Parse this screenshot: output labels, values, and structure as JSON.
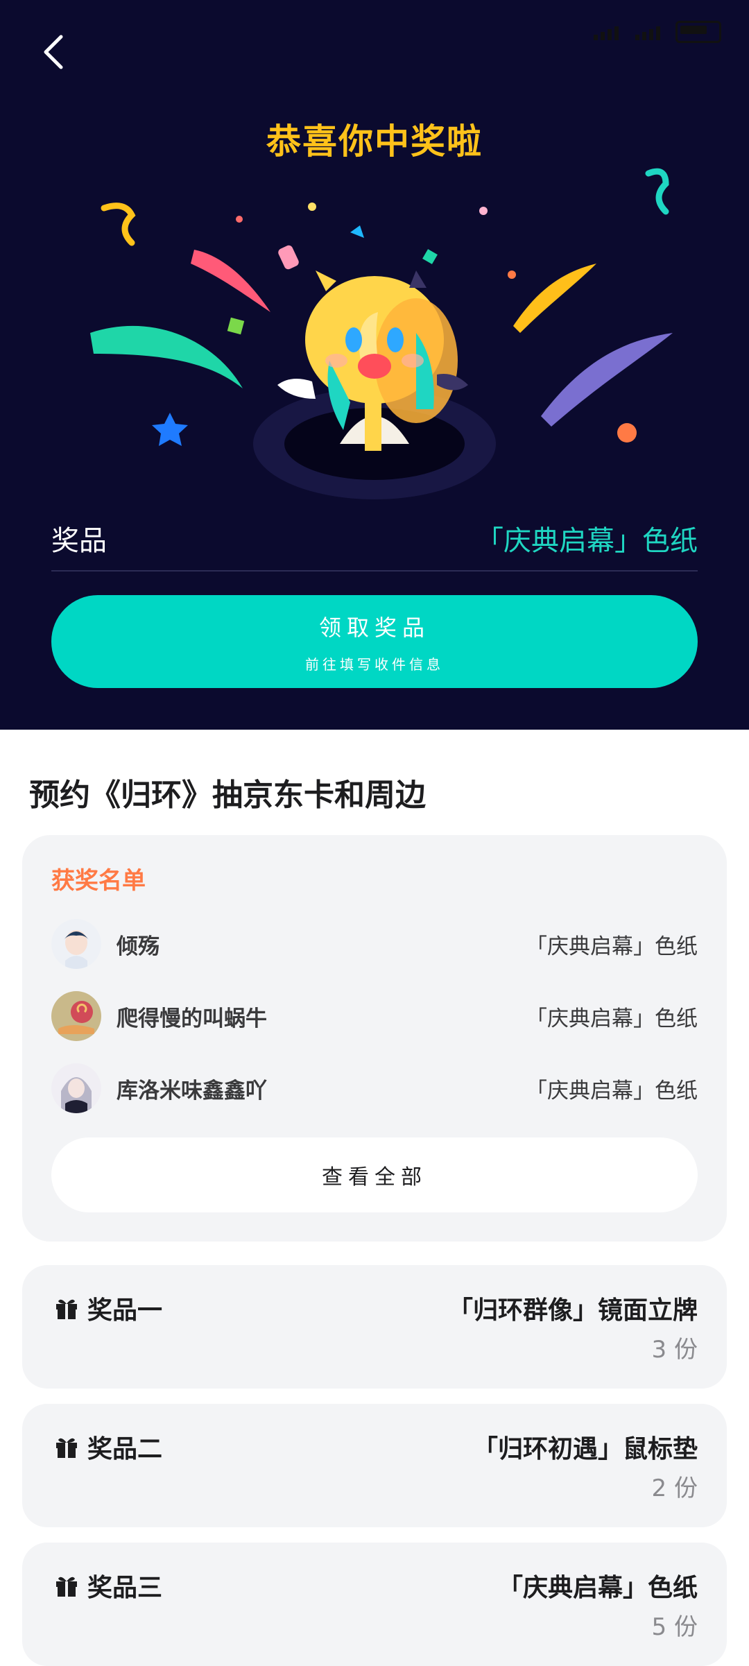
{
  "header": {
    "back_icon": "chevron-left-icon"
  },
  "hero": {
    "title": "恭喜你中奖啦",
    "prize_label": "奖品",
    "prize_value": "「庆典启幕」色纸",
    "claim_button": {
      "label": "领取奖品",
      "sublabel": "前往填写收件信息"
    }
  },
  "section": {
    "title": "预约《归环》抽京东卡和周边"
  },
  "winners": {
    "header": "获奖名单",
    "rows": [
      {
        "name": "倾殇",
        "prize": "「庆典启幕」色纸"
      },
      {
        "name": "爬得慢的叫蜗牛",
        "prize": "「庆典启幕」色纸"
      },
      {
        "name": "库洛米味鑫鑫吖",
        "prize": "「庆典启幕」色纸"
      }
    ],
    "view_all": "查看全部"
  },
  "prizes": [
    {
      "tier": "奖品一",
      "item": "「归环群像」镜面立牌",
      "count": "3 份"
    },
    {
      "tier": "奖品二",
      "item": "「归环初遇」鼠标垫",
      "count": "2 份"
    },
    {
      "tier": "奖品三",
      "item": "「庆典启幕」色纸",
      "count": "5 份"
    }
  ],
  "colors": {
    "hero_bg": "#0b0a2e",
    "title_yellow": "#ffc21a",
    "accent_teal": "#00d7c4",
    "winners_header": "#ff7a45"
  }
}
